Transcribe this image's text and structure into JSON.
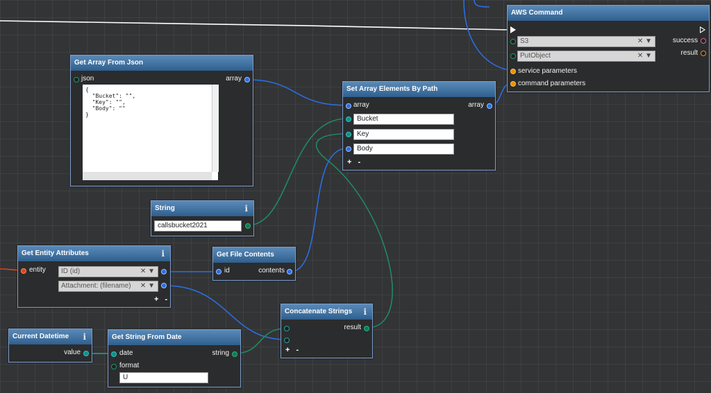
{
  "colors": {
    "canvas": "#333436",
    "node_border": "#7d9cc8",
    "header_top": "#5a8ab8",
    "header_bottom": "#2f5f8e",
    "wire_white": "#ffffff",
    "wire_blue": "#2a6fe0",
    "wire_green": "#1f8a60",
    "wire_red": "#e0441a"
  },
  "icons": {
    "info": "i"
  },
  "nodes": {
    "aws": {
      "title": "AWS Command",
      "service": "S3",
      "operation": "PutObject",
      "clear_glyph": "✕",
      "drop_glyph": "▼",
      "in_service_params": "service parameters",
      "in_command_params": "command parameters",
      "out_success": "success",
      "out_result": "result"
    },
    "get_array": {
      "title": "Get Array From Json",
      "in_json": "json",
      "out_array": "array",
      "json_text": "{\n  \"Bucket\": \"\",\n  \"Key\": \"\",\n  \"Body\": \"\"\n}"
    },
    "set_array": {
      "title": "Set Array Elements By Path",
      "in_array": "array",
      "out_array": "array",
      "path1": "Bucket",
      "path2": "Key",
      "path3": "Body",
      "plus_minus": "+ -"
    },
    "string": {
      "title": "String",
      "value": "callsbucket2021"
    },
    "entity": {
      "title": "Get Entity Attributes",
      "in_entity": "entity",
      "attr1": "ID (id)",
      "attr2": "Attachment: (filename)",
      "plus_minus": "+ -"
    },
    "file": {
      "title": "Get File Contents",
      "in_id": "id",
      "out_contents": "contents"
    },
    "concat": {
      "title": "Concatenate Strings",
      "out_result": "result",
      "plus_minus": "+ -"
    },
    "datetime": {
      "title": "Current Datetime",
      "out_value": "value"
    },
    "strdate": {
      "title": "Get String From Date",
      "in_date": "date",
      "in_format": "format",
      "out_string": "string",
      "format_value": "U"
    }
  }
}
